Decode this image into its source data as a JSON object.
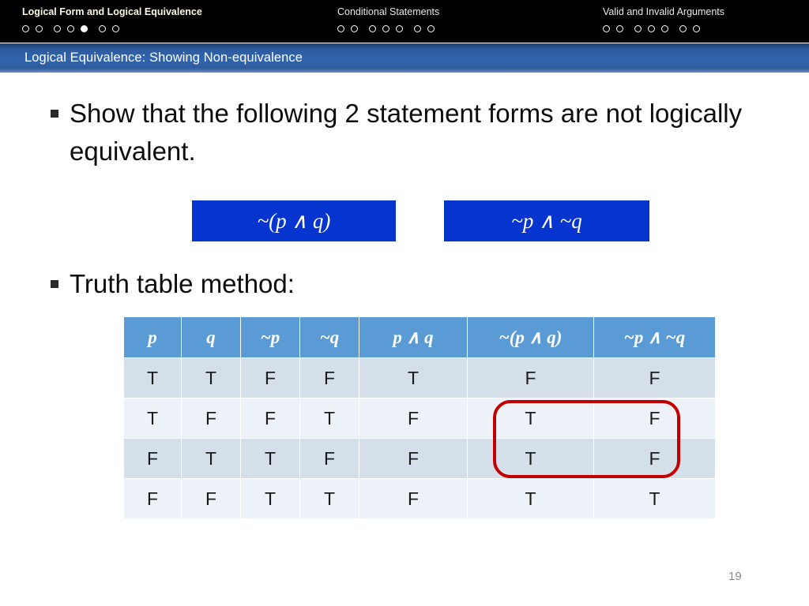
{
  "topnav": {
    "groups": [
      {
        "title": "Logical Form and Logical Equivalence",
        "dots_total": 7,
        "dots_active_index": 4,
        "active": true
      },
      {
        "title": "Conditional Statements",
        "dots_total": 7,
        "dots_active_index": -1,
        "active": false
      },
      {
        "title": "Valid and Invalid Arguments",
        "dots_total": 7,
        "dots_active_index": -1,
        "active": false
      }
    ]
  },
  "titlebar": {
    "text": "Logical Equivalence: Showing Non-equivalence",
    "background_start": "#1d3f73",
    "background_end": "#3164ae"
  },
  "body": {
    "bullet1": "Show that the following 2 statement forms are not logically equivalent.",
    "bullet2": "Truth table method:"
  },
  "formulas": [
    {
      "name": "negation-of-conjunction",
      "prefix": "~(",
      "left": "p",
      "operator": "∧",
      "right": "q",
      "suffix": ")",
      "full": "~(p ∧ q)",
      "background": "#0534cf",
      "color": "#ffffff"
    },
    {
      "name": "conjunction-of-negations",
      "prefix": "~",
      "left": "p",
      "operator": "∧",
      "right": "~q",
      "suffix": "",
      "full": "~p ∧ ~q",
      "background": "#0534cf",
      "color": "#ffffff"
    }
  ],
  "chart_data": {
    "type": "table",
    "title": "Truth table for ~(p ∧ q) and ~p ∧ ~q",
    "columns": [
      "p",
      "q",
      "~p",
      "~q",
      "p ∧ q",
      "~(p ∧ q)",
      "~p ∧ ~q"
    ],
    "rows": [
      [
        "T",
        "T",
        "F",
        "F",
        "T",
        "F",
        "F"
      ],
      [
        "T",
        "F",
        "F",
        "T",
        "F",
        "T",
        "F"
      ],
      [
        "F",
        "T",
        "T",
        "F",
        "F",
        "T",
        "F"
      ],
      [
        "F",
        "F",
        "T",
        "T",
        "F",
        "T",
        "T"
      ]
    ],
    "header_background": "#5b9bd5",
    "row_band_colors": [
      "#d5dfea",
      "#edf1f8"
    ],
    "annotation": {
      "shape": "rounded-rectangle",
      "color": "#c00000",
      "covers_columns": [
        "~(p ∧ q)",
        "~p ∧ ~q"
      ],
      "covers_rows": [
        2,
        3
      ],
      "meaning": "rows where the two statement forms differ"
    }
  },
  "footer": {
    "page_number": "19"
  }
}
